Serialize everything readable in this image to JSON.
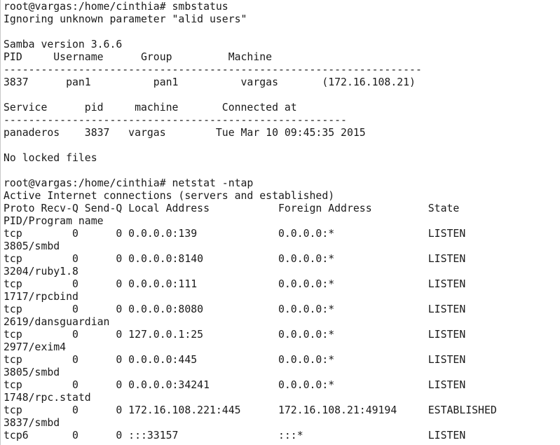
{
  "terminal": {
    "lines": [
      "root@vargas:/home/cinthia# smbstatus",
      "Ignoring unknown parameter \"alid users\"",
      "",
      "Samba version 3.6.6",
      "PID     Username      Group         Machine",
      "-------------------------------------------------------------------",
      "3837      pan1          pan1          vargas       (172.16.108.21)",
      "",
      "Service      pid     machine       Connected at",
      "-------------------------------------------------------",
      "panaderos    3837   vargas        Tue Mar 10 09:45:35 2015",
      "",
      "No locked files",
      "",
      "root@vargas:/home/cinthia# netstat -ntap",
      "Active Internet connections (servers and established)",
      "Proto Recv-Q Send-Q Local Address           Foreign Address         State",
      "PID/Program name",
      "tcp        0      0 0.0.0.0:139             0.0.0.0:*               LISTEN",
      "3805/smbd",
      "tcp        0      0 0.0.0.0:8140            0.0.0.0:*               LISTEN",
      "3204/ruby1.8",
      "tcp        0      0 0.0.0.0:111             0.0.0.0:*               LISTEN",
      "1717/rpcbind",
      "tcp        0      0 0.0.0.0:8080            0.0.0.0:*               LISTEN",
      "2619/dansguardian",
      "tcp        0      0 127.0.0.1:25            0.0.0.0:*               LISTEN",
      "2977/exim4",
      "tcp        0      0 0.0.0.0:445             0.0.0.0:*               LISTEN",
      "3805/smbd",
      "tcp        0      0 0.0.0.0:34241           0.0.0.0:*               LISTEN",
      "1748/rpc.statd",
      "tcp        0      0 172.16.108.221:445      172.16.108.21:49194     ESTABLISHED",
      "3837/smbd",
      "tcp6       0      0 :::33157                :::*                    LISTEN"
    ]
  }
}
